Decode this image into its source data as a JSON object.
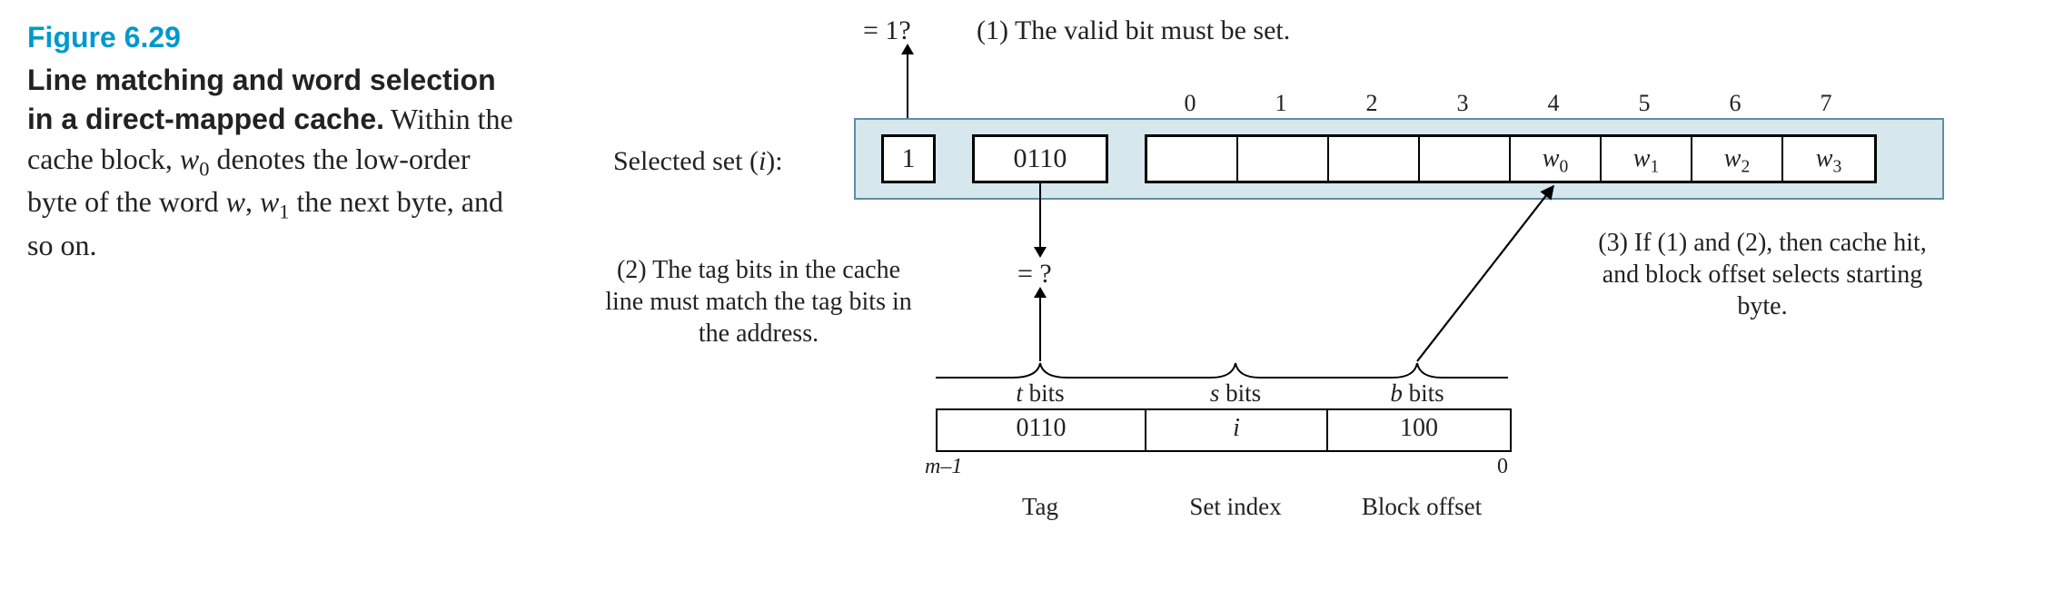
{
  "figure": {
    "number": "Figure 6.29",
    "title": "Line matching and word selection in a direct-mapped cache.",
    "body_prefix": " Within the cache block, ",
    "w0": "w",
    "w0_sub": "0",
    "body_mid1": " denotes the low-order byte of the word ",
    "w": "w",
    "body_mid2": ", ",
    "w1": "w",
    "w1_sub": "1",
    "body_suffix": " the next byte, and so on."
  },
  "diagram": {
    "selected_label": "Selected set (i):",
    "valid_value": "1",
    "tag_value": "0110",
    "byte_indices": [
      "0",
      "1",
      "2",
      "3",
      "4",
      "5",
      "6",
      "7"
    ],
    "block_cells": [
      "",
      "",
      "",
      "",
      "w0",
      "w1",
      "w2",
      "w3"
    ],
    "block_cells_plain": [
      "",
      "",
      "",
      "",
      "w₀",
      "w₁",
      "w₂",
      "w₃"
    ],
    "eq1": "= 1?",
    "step1": "(1) The valid bit must be set.",
    "eqq": "= ?",
    "step2": "(2) The tag bits in the cache line must match the tag bits in the address.",
    "step3": "(3) If (1) and (2), then cache hit, and block offset selects starting byte.",
    "addr_headers": {
      "t": "t bits",
      "s": "s bits",
      "b": "b bits"
    },
    "addr_values": {
      "tag": "0110",
      "set": "i",
      "off": "100"
    },
    "addr_footers": {
      "tag": "Tag",
      "set": "Set index",
      "off": "Block offset"
    },
    "m_minus_1": "m–1",
    "zero": "0"
  }
}
